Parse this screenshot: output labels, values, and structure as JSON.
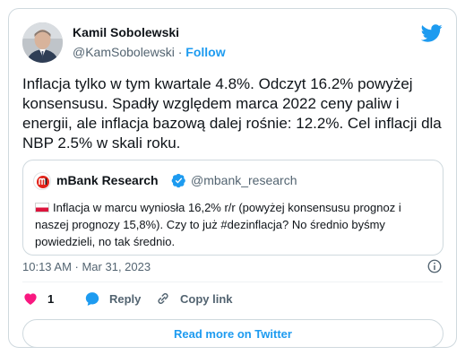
{
  "author": {
    "name": "Kamil Sobolewski",
    "handle": "@KamSobolewski",
    "separator": "·",
    "follow_label": "Follow"
  },
  "tweet": {
    "text": "Inflacja tylko w tym kwartale 4.8%. Odczyt 16.2% powyżej konsensusu. Spadły względem marca 2022 ceny paliw i energii, ale inflacja bazową dalej rośnie: 12.2%. Cel inflacji dla NBP 2.5% w skali roku."
  },
  "quote": {
    "name": "mBank Research",
    "handle": "@mbank_research",
    "text": "Inflacja w marcu wyniosła 16,2% r/r (powyżej konsensusu prognoz i naszej prognozy 15,8%). Czy to już #dezinflacja? No średnio byśmy powiedzieli, no tak średnio."
  },
  "timestamp": "10:13 AM · Mar 31, 2023",
  "actions": {
    "like_count": "1",
    "reply_label": "Reply",
    "copy_label": "Copy link"
  },
  "read_more_label": "Read more on Twitter",
  "icons": [
    "twitter-bird-icon",
    "verified-badge-icon",
    "info-icon",
    "heart-icon",
    "reply-icon",
    "link-icon",
    "poland-flag-icon"
  ],
  "colors": {
    "accent": "#1d9bf0",
    "like": "#f91880",
    "muted": "#536471",
    "text": "#0f1419",
    "border": "#cfd9de"
  }
}
